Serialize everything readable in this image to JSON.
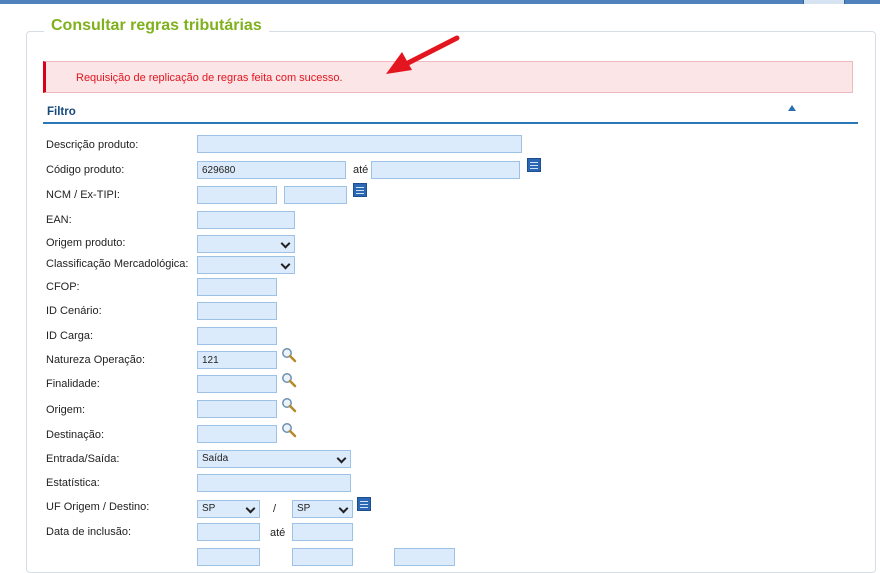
{
  "window": {
    "title": "Consultar regras tributárias"
  },
  "alert": {
    "message": "Requisição de replicação de regras feita com sucesso."
  },
  "filter": {
    "title": "Filtro"
  },
  "fields": {
    "descricao_produto": {
      "label": "Descrição produto:",
      "value": ""
    },
    "codigo_produto": {
      "label": "Código produto:",
      "value": "629680",
      "to_label": "até",
      "to_value": ""
    },
    "ncm": {
      "label": "NCM / Ex-TIPI:",
      "value": "",
      "ex_value": ""
    },
    "ean": {
      "label": "EAN:",
      "value": ""
    },
    "origem_produto": {
      "label": "Origem produto:",
      "value": ""
    },
    "classificacao": {
      "label": "Classificação Mercadológica:",
      "value": ""
    },
    "cfop": {
      "label": "CFOP:",
      "value": ""
    },
    "id_cenario": {
      "label": "ID Cenário:",
      "value": ""
    },
    "id_carga": {
      "label": "ID Carga:",
      "value": ""
    },
    "natureza_operacao": {
      "label": "Natureza Operação:",
      "value": "121"
    },
    "finalidade": {
      "label": "Finalidade:",
      "value": ""
    },
    "origem": {
      "label": "Origem:",
      "value": ""
    },
    "destinacao": {
      "label": "Destinação:",
      "value": ""
    },
    "entrada_saida": {
      "label": "Entrada/Saída:",
      "value": "Saída"
    },
    "estatistica": {
      "label": "Estatística:",
      "value": ""
    },
    "uf": {
      "label": "UF Origem / Destino:",
      "origem": "SP",
      "separator": "/",
      "destino": "SP"
    },
    "data_inclusao": {
      "label": "Data de inclusão:",
      "from": "",
      "to_label": "até",
      "to": ""
    }
  },
  "icons": {
    "list": "list-icon",
    "search": "magnifier-icon",
    "collapse": "triangle-up-icon",
    "arrow": "red-arrow-icon"
  },
  "colors": {
    "title": "#7fb11d",
    "alert_text": "#e3151f",
    "alert_bg": "#fbe5e7",
    "input_bg": "#dcebfb",
    "header": "#14497e"
  }
}
